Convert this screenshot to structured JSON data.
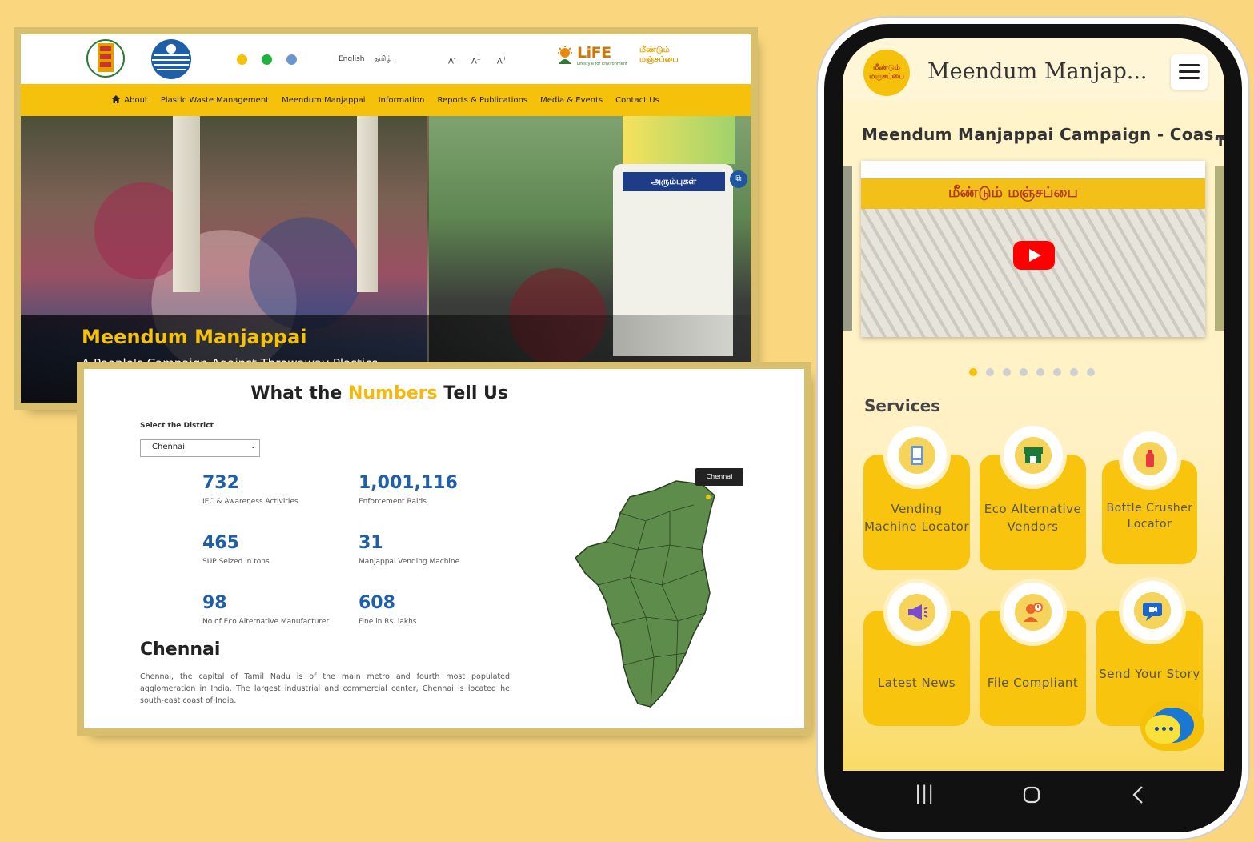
{
  "website": {
    "header": {
      "lang_english": "English",
      "lang_tamil": "தமிழ்",
      "font_small": "A",
      "font_normal": "A",
      "font_large": "A",
      "life_logo": "LiFE",
      "life_subtitle": "Lifestyle for Environment",
      "manjappai_logo": "மீண்டும் மஞ்சப்பை",
      "dot_colors": [
        "#F4C20D",
        "#1DB33E",
        "#6C95CF"
      ]
    },
    "nav": {
      "items": [
        "About",
        "Plastic Waste Management",
        "Meendum Manjappai",
        "Information",
        "Reports & Publications",
        "Media & Events",
        "Contact Us"
      ]
    },
    "hero": {
      "title": "Meendum Manjappai",
      "subtitle": "A People's Campaign Against Throwaway Plastics",
      "bus_sign": "அரும்புகள்"
    }
  },
  "numbers": {
    "title_pre": "What the",
    "title_highlight": "Numbers",
    "title_post": " Tell Us",
    "district_label": "Select the District",
    "district_value": "Chennai",
    "stats": [
      {
        "value": "732",
        "label": "IEC & Awareness Activities"
      },
      {
        "value": "1,001,116",
        "label": "Enforcement Raids"
      },
      {
        "value": "465",
        "label": "SUP Seized in tons"
      },
      {
        "value": "31",
        "label": "Manjappai Vending Machine"
      },
      {
        "value": "98",
        "label": "No of Eco Alternative Manufacturer"
      },
      {
        "value": "608",
        "label": "Fine in Rs. lakhs"
      }
    ],
    "city_title": "Chennai",
    "city_description": "Chennai, the capital of Tamil Nadu is of the main metro and fourth most populated agglomeration in India. The largest industrial and commercial center, Chennai is located he south-east coast of India.",
    "map_tooltip": "Chennai",
    "map_color": "#5E8C4A"
  },
  "mobile": {
    "app_title": "Meendum Manjap...",
    "logo_text": "மீண்டும் மஞ்சப்பை",
    "video_title": "Meendum Manjappai Campaign - Coas...",
    "video_next": "T",
    "video_sign": "மீண்டும் மஞ்சப்பை",
    "carousel_total": 8,
    "carousel_active": 1,
    "services_heading": "Services",
    "services": [
      {
        "label": "Vending Machine Locator",
        "icon": "vending-machine-icon"
      },
      {
        "label": "Eco Alternative Vendors",
        "icon": "store-icon"
      },
      {
        "label": "Bottle Crusher Locator",
        "icon": "bottle-icon"
      },
      {
        "label": "Latest News",
        "icon": "megaphone-icon"
      },
      {
        "label": "File Compliant",
        "icon": "complaint-icon"
      },
      {
        "label": "Send Your Story",
        "icon": "video-message-icon"
      }
    ],
    "accent_color": "#F8C40D"
  }
}
